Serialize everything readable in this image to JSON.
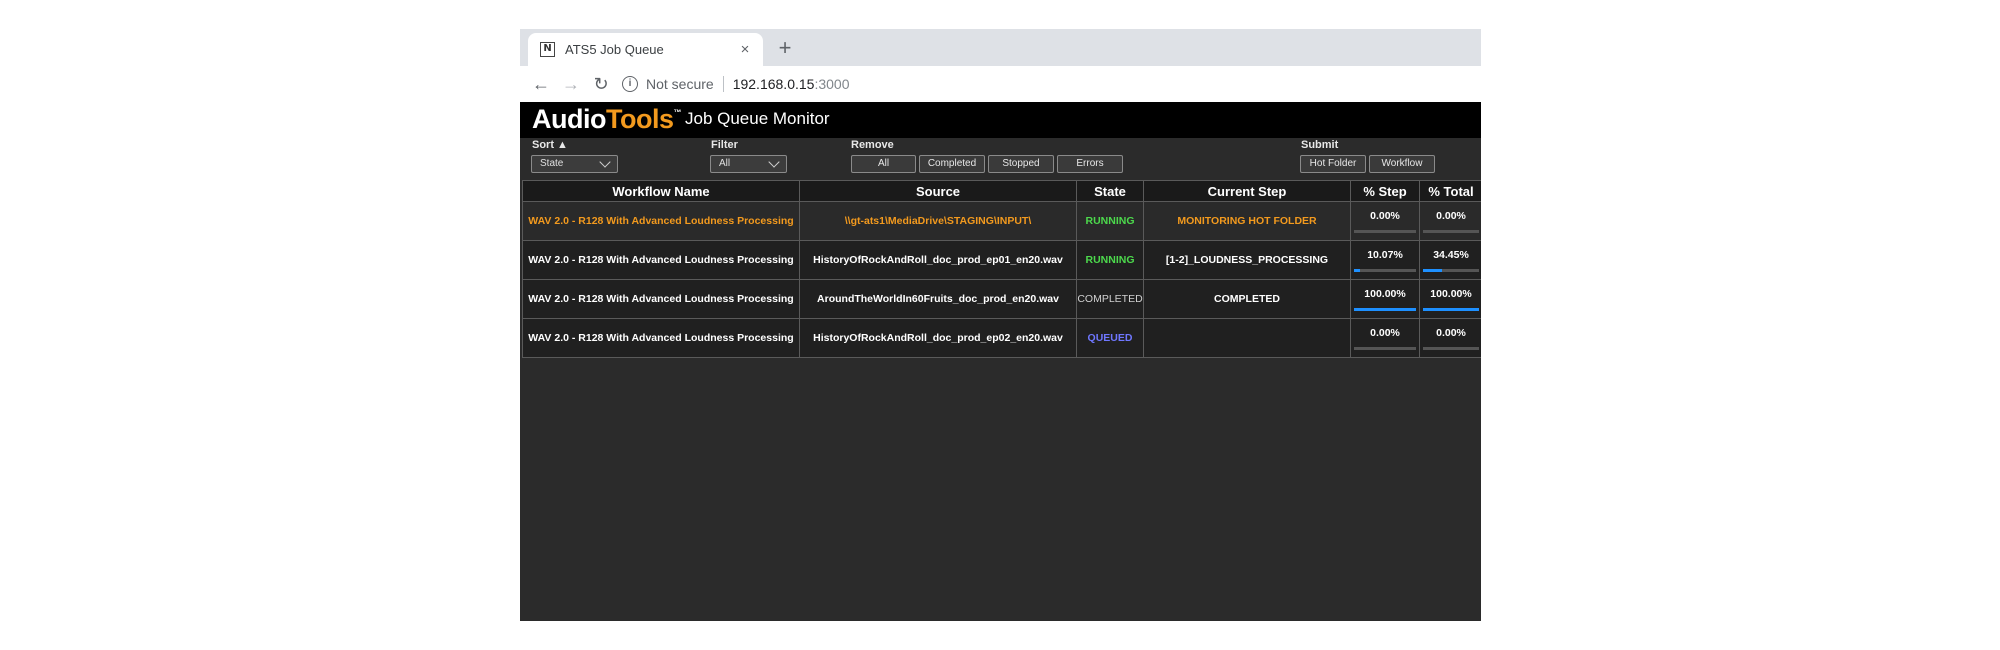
{
  "browser": {
    "tab_title": "ATS5 Job Queue",
    "tab_close": "×",
    "new_tab": "+",
    "favicon_text": "N",
    "not_secure": "Not secure",
    "url_host": "192.168.0.15",
    "url_port": ":3000",
    "icons": {
      "back": "arrow-left",
      "forward": "arrow-right",
      "reload": "reload",
      "info": "info-circle"
    }
  },
  "app": {
    "logo_audio": "Audio",
    "logo_tools": "Tools",
    "logo_tm": "™",
    "title": "Job Queue Monitor",
    "accent_color": "#f39a1e"
  },
  "controls": {
    "sort_label": "Sort ▲",
    "sort_value": "State",
    "filter_label": "Filter",
    "filter_value": "All",
    "remove_label": "Remove",
    "remove_buttons": [
      "All",
      "Completed",
      "Stopped",
      "Errors"
    ],
    "submit_label": "Submit",
    "submit_buttons": [
      "Hot Folder",
      "Workflow"
    ]
  },
  "table": {
    "headers": [
      "Workflow Name",
      "Source",
      "State",
      "Current Step",
      "% Step",
      "% Total"
    ],
    "rows": [
      {
        "workflow": "WAV 2.0 - R128 With Advanced Loudness Processing",
        "source": "\\\\gt-ats1\\MediaDrive\\STAGING\\INPUT\\",
        "state": "RUNNING",
        "step": "MONITORING HOT FOLDER",
        "pct_step": "0.00%",
        "pct_total": "0.00%",
        "step_fraction": 0.0,
        "total_fraction": 0.0
      },
      {
        "workflow": "WAV 2.0 - R128 With Advanced Loudness Processing",
        "source": "HistoryOfRockAndRoll_doc_prod_ep01_en20.wav",
        "state": "RUNNING",
        "step": "[1-2]_LOUDNESS_PROCESSING",
        "pct_step": "10.07%",
        "pct_total": "34.45%",
        "step_fraction": 0.1007,
        "total_fraction": 0.3445
      },
      {
        "workflow": "WAV 2.0 - R128 With Advanced Loudness Processing",
        "source": "AroundTheWorldIn60Fruits_doc_prod_en20.wav",
        "state": "COMPLETED",
        "step": "COMPLETED",
        "pct_step": "100.00%",
        "pct_total": "100.00%",
        "step_fraction": 1.0,
        "total_fraction": 1.0
      },
      {
        "workflow": "WAV 2.0 - R128 With Advanced Loudness Processing",
        "source": "HistoryOfRockAndRoll_doc_prod_ep02_en20.wav",
        "state": "QUEUED",
        "step": "",
        "pct_step": "0.00%",
        "pct_total": "0.00%",
        "step_fraction": 0.0,
        "total_fraction": 0.0
      }
    ]
  },
  "colors": {
    "running": "#4cd94c",
    "queued": "#6f77ff",
    "progress": "#1e90ff"
  }
}
